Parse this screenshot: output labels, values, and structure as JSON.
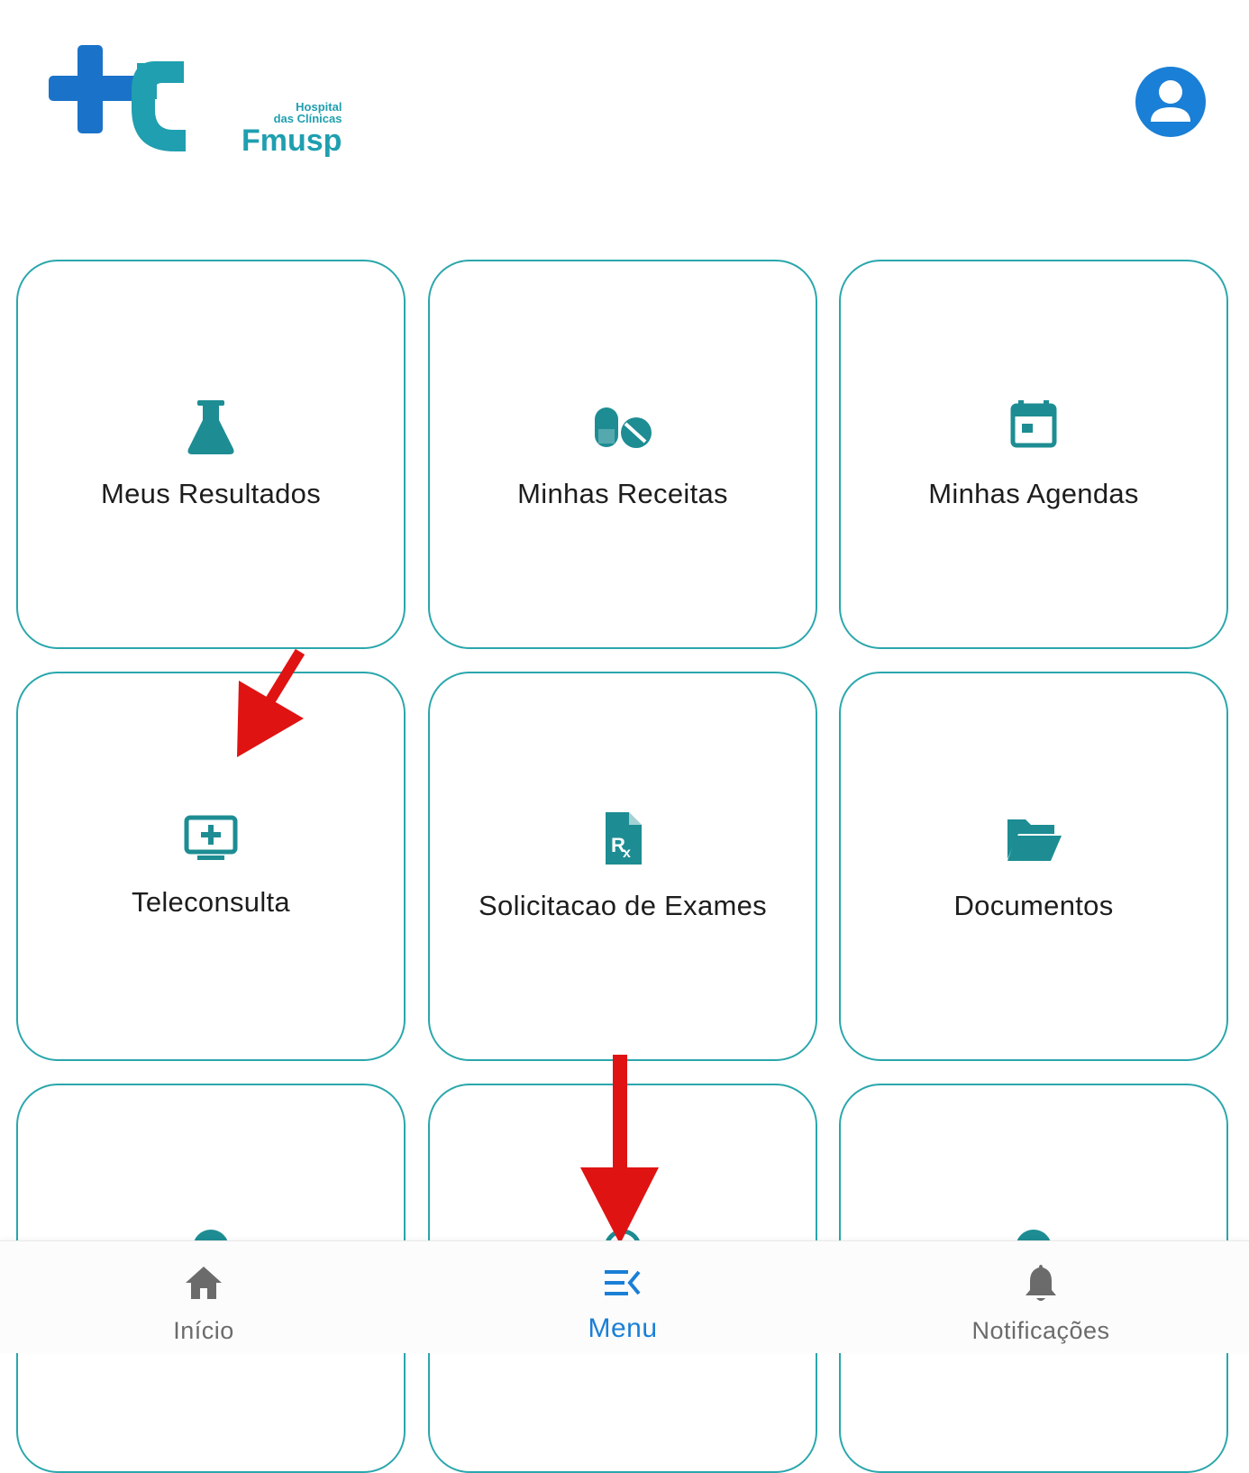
{
  "header": {
    "logo": {
      "line1": "Hospital",
      "line2": "das Clínicas",
      "line3": "Fmusp",
      "colors": {
        "blue": "#1a73c9",
        "teal": "#1f9fb0"
      }
    },
    "profile_icon": "account-circle-icon"
  },
  "tiles": [
    {
      "label": "Meus Resultados",
      "icon": "flask-icon"
    },
    {
      "label": "Minhas Receitas",
      "icon": "pills-icon"
    },
    {
      "label": "Minhas Agendas",
      "icon": "calendar-icon"
    },
    {
      "label": "Teleconsulta",
      "icon": "monitor-plus-icon"
    },
    {
      "label": "Solicitacao de Exames",
      "icon": "prescription-icon"
    },
    {
      "label": "Documentos",
      "icon": "folder-open-icon"
    }
  ],
  "bottom_nav": {
    "items": [
      {
        "label": "Início",
        "icon": "home-icon",
        "active": false
      },
      {
        "label": "Menu",
        "icon": "menu-open-icon",
        "active": true
      },
      {
        "label": "Notificações",
        "icon": "bell-icon",
        "active": false
      }
    ]
  },
  "colors": {
    "accent_teal": "#2aa7ac",
    "icon_teal": "#1d8d93",
    "active_blue": "#1a7fd6",
    "annotation_red": "#e01313"
  }
}
